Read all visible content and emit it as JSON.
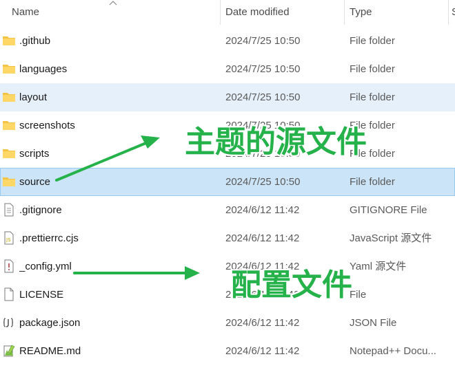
{
  "header": {
    "name": "Name",
    "date_modified": "Date modified",
    "type": "Type",
    "size_partial": "S"
  },
  "files": [
    {
      "name": ".github",
      "date": "2024/7/25 10:50",
      "type": "File folder",
      "icon": "folder-icon"
    },
    {
      "name": "languages",
      "date": "2024/7/25 10:50",
      "type": "File folder",
      "icon": "folder-icon"
    },
    {
      "name": "layout",
      "date": "2024/7/25 10:50",
      "type": "File folder",
      "icon": "folder-icon"
    },
    {
      "name": "screenshots",
      "date": "2024/7/25 10:50",
      "type": "File folder",
      "icon": "folder-icon"
    },
    {
      "name": "scripts",
      "date": "2024/7/25 10:50",
      "type": "File folder",
      "icon": "folder-icon"
    },
    {
      "name": "source",
      "date": "2024/7/25 10:50",
      "type": "File folder",
      "icon": "folder-icon"
    },
    {
      "name": ".gitignore",
      "date": "2024/6/12 11:42",
      "type": "GITIGNORE File",
      "icon": "text-file-icon"
    },
    {
      "name": ".prettierrc.cjs",
      "date": "2024/6/12 11:42",
      "type": "JavaScript 源文件",
      "icon": "js-file-icon"
    },
    {
      "name": "_config.yml",
      "date": "2024/6/12 11:42",
      "type": "Yaml 源文件",
      "icon": "yaml-file-icon"
    },
    {
      "name": "LICENSE",
      "date": "2024/6/12 11:42",
      "type": "File",
      "icon": "blank-file-icon"
    },
    {
      "name": "package.json",
      "date": "2024/6/12 11:42",
      "type": "JSON File",
      "icon": "json-file-icon"
    },
    {
      "name": "README.md",
      "date": "2024/6/12 11:42",
      "type": "Notepad++ Docu...",
      "icon": "notepadpp-file-icon"
    }
  ],
  "annotations": {
    "theme_source": "主题的源文件",
    "config_file": "配置文件"
  },
  "colors": {
    "annotation_green": "#25b24a",
    "hover_row": "#e6f0fb",
    "selected_row": "#cce4f7",
    "folder_yellow": "#f5c344"
  }
}
